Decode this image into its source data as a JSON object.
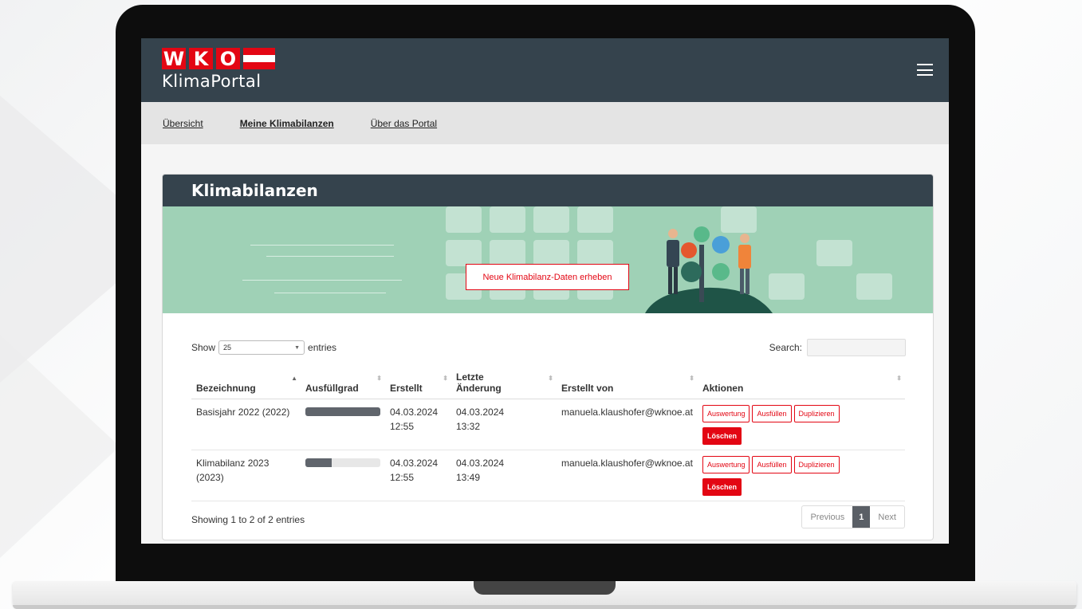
{
  "header": {
    "logo_letters": [
      "W",
      "K",
      "O"
    ],
    "logo_subtitle": "KlimaPortal"
  },
  "nav": {
    "items": [
      {
        "label": "Übersicht",
        "active": false
      },
      {
        "label": "Meine Klimabilanzen",
        "active": true
      },
      {
        "label": "Über das Portal",
        "active": false
      }
    ]
  },
  "card": {
    "title": "Klimabilanzen",
    "banner_button": "Neue Klimabilanz-Daten erheben"
  },
  "table_controls": {
    "show_label": "Show",
    "page_size": "25",
    "entries_label": "entries",
    "search_label": "Search:",
    "search_value": ""
  },
  "table": {
    "headers": [
      "Bezeichnung",
      "Ausfüllgrad",
      "Erstellt",
      "Letzte Änderung",
      "Erstellt von",
      "Aktionen"
    ],
    "rows": [
      {
        "name": "Basisjahr 2022 (2022)",
        "progress": 1.0,
        "created_date": "04.03.2024",
        "created_time": "12:55",
        "changed_date": "04.03.2024",
        "changed_time": "13:32",
        "author": "manuela.klaushofer@wknoe.at"
      },
      {
        "name": "Klimabilanz 2023 (2023)",
        "progress": 0.35,
        "created_date": "04.03.2024",
        "created_time": "12:55",
        "changed_date": "04.03.2024",
        "changed_time": "13:49",
        "author": "manuela.klaushofer@wknoe.at"
      }
    ],
    "actions": {
      "auswertung": "Auswertung",
      "ausfuellen": "Ausfüllen",
      "duplizieren": "Duplizieren",
      "loeschen": "Löschen"
    }
  },
  "footer": {
    "info": "Showing 1 to 2 of 2 entries",
    "previous": "Previous",
    "current_page": "1",
    "next": "Next"
  },
  "colors": {
    "header_bg": "#35434d",
    "accent_red": "#e30613",
    "banner_green": "#9fd1b6"
  }
}
